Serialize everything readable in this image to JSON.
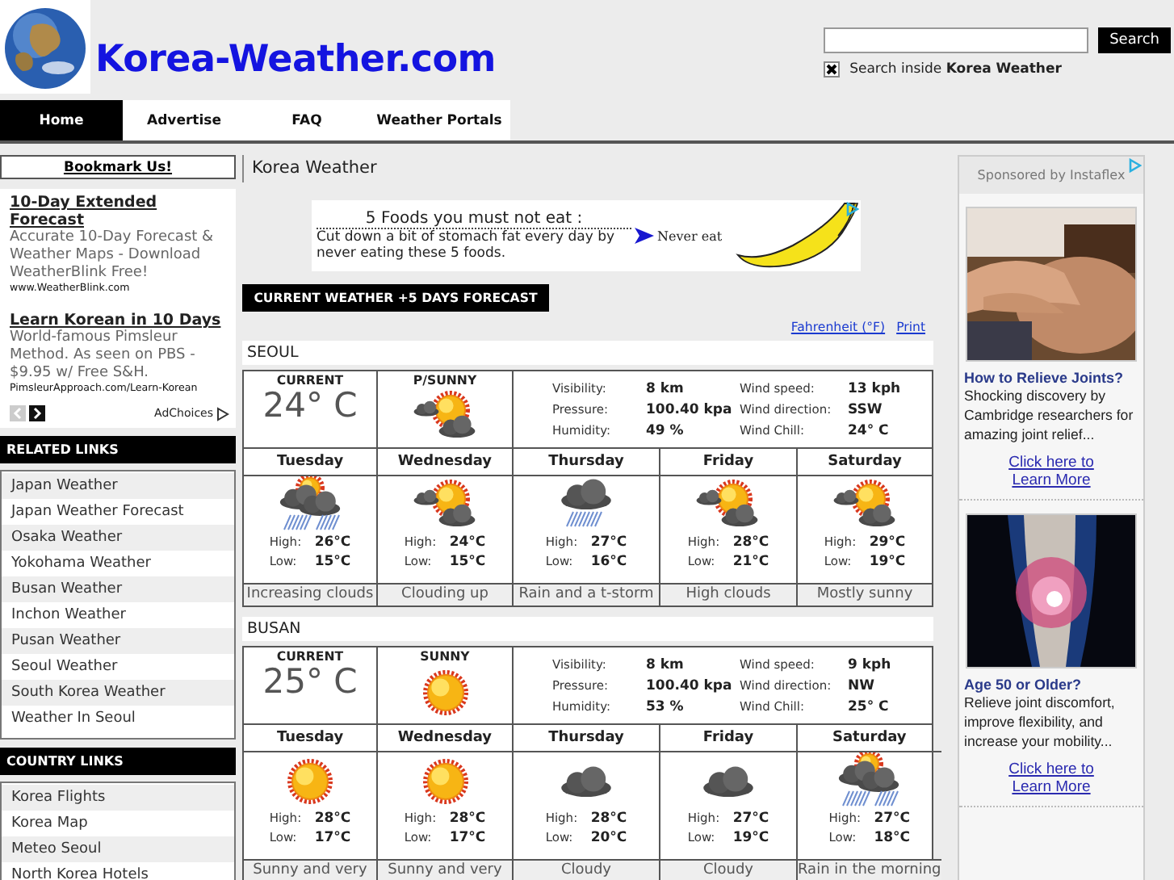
{
  "header": {
    "site_title": "Korea-Weather.com",
    "search": {
      "button": "Search",
      "option": {
        "label": "Search inside **Korea Weather**",
        "checked": true
      }
    }
  },
  "nav": [
    {
      "label": "Home",
      "selected": true
    },
    {
      "label": "Advertise",
      "selected": false
    },
    {
      "label": "FAQ",
      "selected": false
    },
    {
      "label": "Weather Portals",
      "selected": false
    }
  ],
  "sidebar": {
    "bookmark": "Bookmark Us!",
    "ads": [
      {
        "title": "10-Day Extended Forecast",
        "text": "Accurate 10-Day Forecast & Weather Maps - Download WeatherBlink Free!",
        "url": "www.WeatherBlink.com"
      },
      {
        "title": "Learn Korean in 10 Days",
        "text": "World-famous Pimsleur Method. As seen on PBS - $9.95 w/ Free S&H.",
        "url": "PimsleurApproach.com/Learn-Korean"
      }
    ],
    "adchoices": "AdChoices",
    "sections": [
      {
        "title": "RELATED LINKS",
        "items": [
          "Japan Weather",
          "Japan Weather Forecast",
          "Osaka Weather",
          "Yokohama Weather",
          "Busan Weather",
          "Inchon Weather",
          "Pusan Weather",
          "Seoul Weather",
          "South Korea Weather",
          "Weather In Seoul"
        ]
      },
      {
        "title": "COUNTRY LINKS",
        "items": [
          "Korea Flights",
          "Korea Map",
          "Meteo Seoul",
          "North Korea Hotels"
        ]
      }
    ]
  },
  "main": {
    "heading": "Korea Weather",
    "banner": {
      "headline": "5 Foods you must not eat :",
      "text": "Cut down a bit of stomach fat every day by never eating these 5 foods.",
      "cta": "Never eat"
    },
    "forecast_button": "CURRENT WEATHER +5 DAYS FORECAST",
    "links": [
      "Fahrenheit (°F)",
      "Print"
    ],
    "cities": [
      {
        "name": "SEOUL",
        "current_label": "CURRENT",
        "temperature": "24° C",
        "condition": "P/SUNNY",
        "kind": "sun-cloud",
        "details": [
          {
            "label": "Visibility:",
            "value": "8 km"
          },
          {
            "label": "Wind speed:",
            "value": "13 kph"
          },
          {
            "label": "Pressure:",
            "value": "100.40 kpa"
          },
          {
            "label": "Wind direction:",
            "value": "SSW"
          },
          {
            "label": "Humidity:",
            "value": "49 %"
          },
          {
            "label": "Wind Chill:",
            "value": "24° C"
          }
        ],
        "days": [
          {
            "day": "Tuesday",
            "kind": "sun-rain",
            "high_label": "High:",
            "high": "26°C",
            "low_label": "Low:",
            "low": "15°C",
            "summary": "Increasing clouds"
          },
          {
            "day": "Wednesday",
            "kind": "sun-cloud",
            "high_label": "High:",
            "high": "24°C",
            "low_label": "Low:",
            "low": "15°C",
            "summary": "Clouding up"
          },
          {
            "day": "Thursday",
            "kind": "rain",
            "high_label": "High:",
            "high": "27°C",
            "low_label": "Low:",
            "low": "16°C",
            "summary": "Rain and a t-storm"
          },
          {
            "day": "Friday",
            "kind": "sun-cloud",
            "high_label": "High:",
            "high": "28°C",
            "low_label": "Low:",
            "low": "21°C",
            "summary": "High clouds"
          },
          {
            "day": "Saturday",
            "kind": "sun-cloud",
            "high_label": "High:",
            "high": "29°C",
            "low_label": "Low:",
            "low": "19°C",
            "summary": "Mostly sunny"
          }
        ]
      },
      {
        "name": "BUSAN",
        "current_label": "CURRENT",
        "temperature": "25° C",
        "condition": "SUNNY",
        "kind": "sun",
        "details": [
          {
            "label": "Visibility:",
            "value": "8 km"
          },
          {
            "label": "Wind speed:",
            "value": "9 kph"
          },
          {
            "label": "Pressure:",
            "value": "100.40 kpa"
          },
          {
            "label": "Wind direction:",
            "value": "NW"
          },
          {
            "label": "Humidity:",
            "value": "53 %"
          },
          {
            "label": "Wind Chill:",
            "value": "25° C"
          }
        ],
        "days": [
          {
            "day": "Tuesday",
            "kind": "sun",
            "high_label": "High:",
            "high": "28°C",
            "low_label": "Low:",
            "low": "17°C",
            "summary": "Sunny and very"
          },
          {
            "day": "Wednesday",
            "kind": "sun",
            "high_label": "High:",
            "high": "28°C",
            "low_label": "Low:",
            "low": "17°C",
            "summary": "Sunny and very"
          },
          {
            "day": "Thursday",
            "kind": "cloud",
            "high_label": "High:",
            "high": "28°C",
            "low_label": "Low:",
            "low": "20°C",
            "summary": "Cloudy"
          },
          {
            "day": "Friday",
            "kind": "cloud",
            "high_label": "High:",
            "high": "27°C",
            "low_label": "Low:",
            "low": "19°C",
            "summary": "Cloudy"
          },
          {
            "day": "Saturday",
            "kind": "sun-rain",
            "high_label": "High:",
            "high": "27°C",
            "low_label": "Low:",
            "low": "18°C",
            "summary": "Rain in the morning"
          }
        ]
      }
    ]
  },
  "ad": {
    "sponsor": "Sponsored by Instaflex",
    "items": [
      {
        "title": "How to Relieve Joints?",
        "text": "Shocking discovery by Cambridge researchers for amazing joint relief...",
        "link": "Click here to Learn More"
      },
      {
        "title": "Age 50 or Older?",
        "text": "Relieve joint discomfort, improve flexibility, and increase your mobility...",
        "link": "Click here to Learn More"
      }
    ]
  }
}
